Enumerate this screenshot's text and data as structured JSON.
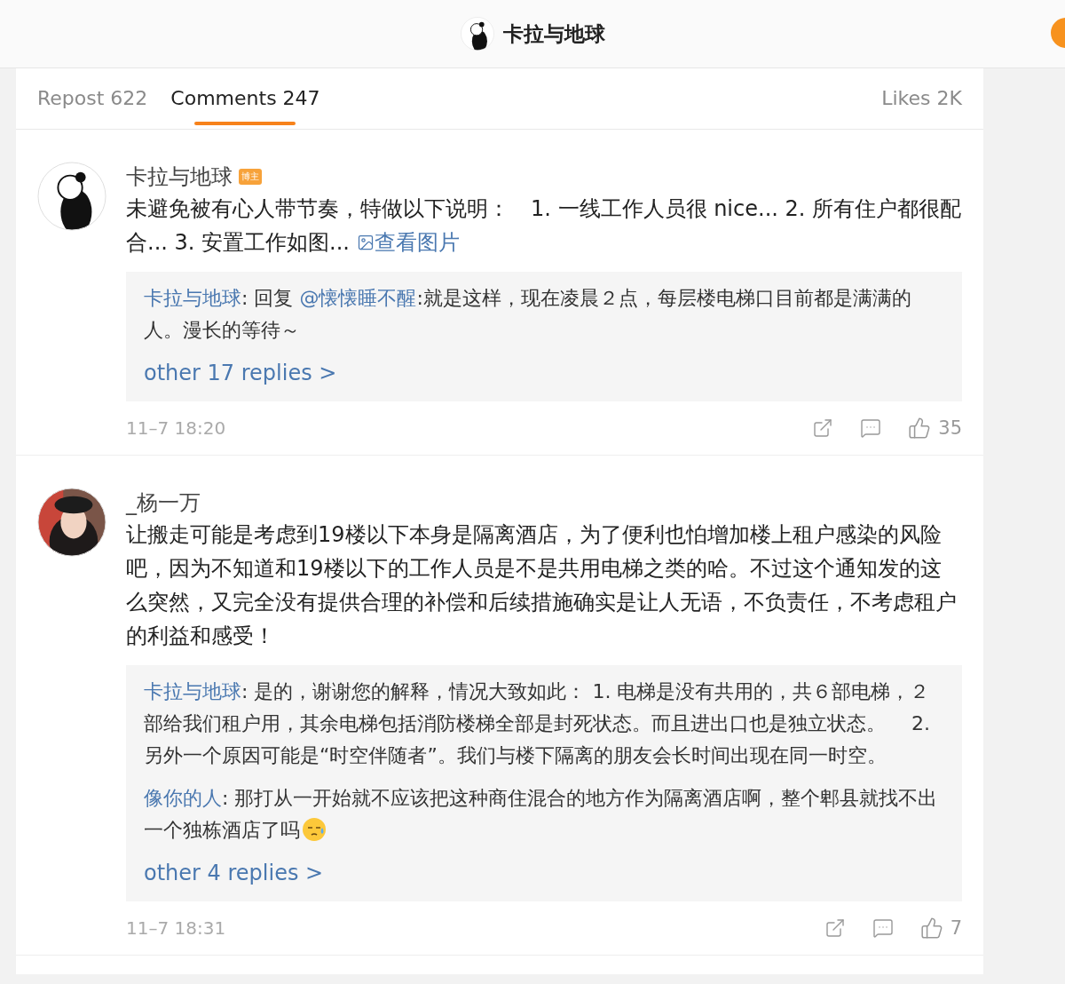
{
  "header": {
    "title": "卡拉与地球"
  },
  "tabs": [
    {
      "label": "Repost 622",
      "selected": false
    },
    {
      "label": "Comments 247",
      "selected": true
    },
    {
      "label": "Likes 2K",
      "selected": false
    }
  ],
  "comments": [
    {
      "author": "卡拉与地球",
      "badge": "博主",
      "kind": "drawing",
      "text": "未避免被有心人带节奏，特做以下说明：　1. 一线工作人员很 nice... 2. 所有住户都很配合... 3. 安置工作如图...",
      "link": "查看图片",
      "replies": [
        {
          "author": "卡拉与地球",
          "kind": "plain",
          "before": ": 回复 ",
          "mention": "@懐懐睡不醒",
          "text": ":就是这样，现在凌晨２点，每层楼电梯口目前都是满满的人。漫长的等待～"
        }
      ],
      "more": "other 17 replies >",
      "time": "11–7 18:20",
      "likes": "35"
    },
    {
      "author": "_杨一万",
      "kind": "photo",
      "text": "让搬走可能是考虑到19楼以下本身是隔离酒店，为了便利也怕增加楼上租户感染的风险吧，因为不知道和19楼以下的工作人员是不是共用电梯之类的哈。不过这个通知发的这么突然，又完全没有提供合理的补偿和后续措施确实是让人无语，不负责任，不考虑租户的利益和感受！",
      "replies": [
        {
          "author": "卡拉与地球",
          "kind": "plain",
          "text": ": 是的，谢谢您的解释，情况大致如此：  1. 电梯是没有共用的，共６部电梯，２部给我们租户用，其余电梯包括消防楼梯全部是封死状态。而且进出口也是独立状态。　 2. 另外一个原因可能是“时空伴随者”。我们与楼下隔离的朋友会长时间出现在同一时空。"
        },
        {
          "author": "像你的人",
          "kind": "emoji",
          "text": ": 那打从一开始就不应该把这种商住混合的地方作为隔离酒店啊，整个郫县就找不出一个独栋酒店了吗"
        }
      ],
      "more": "other 4 replies >",
      "time": "11–7 18:31",
      "likes": "7"
    }
  ]
}
